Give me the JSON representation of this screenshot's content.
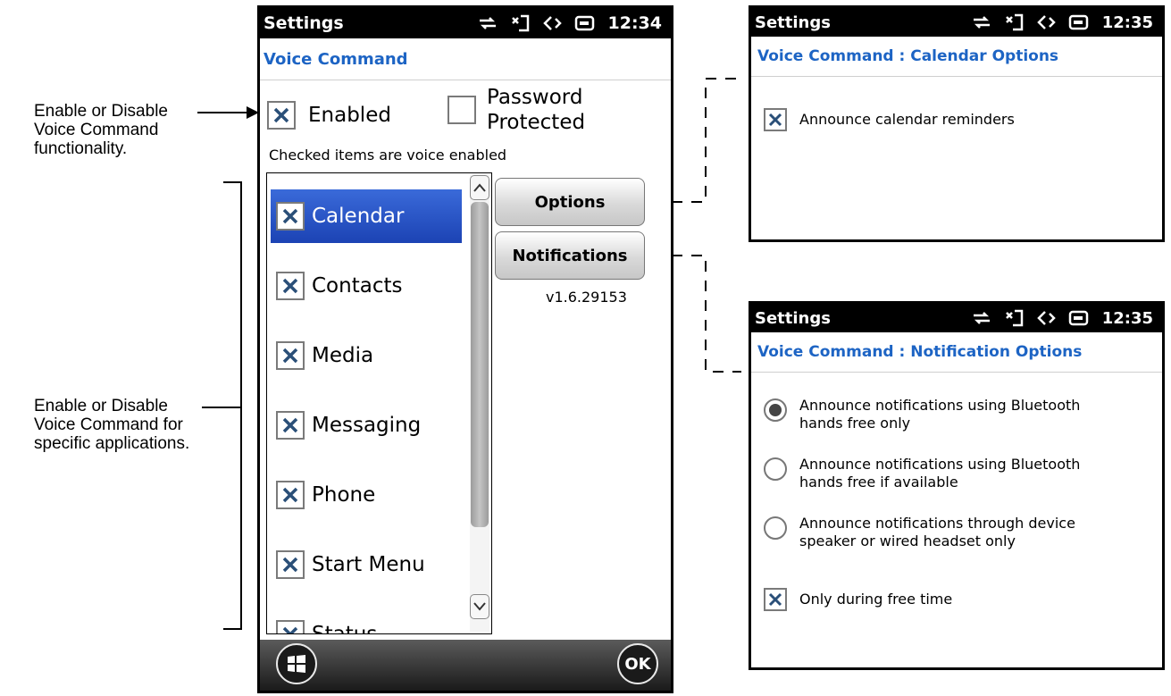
{
  "annotations": {
    "enable_disable_feature": [
      "Enable or Disable",
      "Voice Command",
      "functionality."
    ],
    "enable_disable_apps": [
      "Enable or Disable",
      "Voice Command for",
      "specific applications."
    ]
  },
  "main_screen": {
    "status_title": "Settings",
    "time": "12:34",
    "page_title": "Voice Command",
    "enabled": {
      "label": "Enabled",
      "checked": true
    },
    "password": {
      "label_line1": "Password",
      "label_line2": "Protected",
      "checked": false
    },
    "hint": "Checked items are voice enabled",
    "apps": [
      {
        "label": "Calendar",
        "checked": true,
        "selected": true
      },
      {
        "label": "Contacts",
        "checked": true
      },
      {
        "label": "Media",
        "checked": true
      },
      {
        "label": "Messaging",
        "checked": true
      },
      {
        "label": "Phone",
        "checked": true
      },
      {
        "label": "Start Menu",
        "checked": true
      },
      {
        "label": "Status",
        "checked": true
      }
    ],
    "options_button": "Options",
    "notifications_button": "Notifications",
    "version": "v1.6.29153",
    "ok_button": "OK"
  },
  "calendar_screen": {
    "status_title": "Settings",
    "time": "12:35",
    "page_title": "Voice Command : Calendar Options",
    "announce": {
      "label": "Announce calendar reminders",
      "checked": true
    }
  },
  "notification_screen": {
    "status_title": "Settings",
    "time": "12:35",
    "page_title": "Voice Command : Notification Options",
    "radio_options": [
      {
        "line1": "Announce notifications using Bluetooth",
        "line2": "hands free only",
        "selected": true
      },
      {
        "line1": "Announce notifications using Bluetooth",
        "line2": "hands free if available",
        "selected": false
      },
      {
        "line1": "Announce notifications through device",
        "line2": "speaker or wired headset only",
        "selected": false
      }
    ],
    "free_time": {
      "label": "Only during free time",
      "checked": true
    }
  },
  "colors": {
    "accent_title": "#1d64c4",
    "selection": "#2a55c8",
    "statusbar": "#000000"
  }
}
